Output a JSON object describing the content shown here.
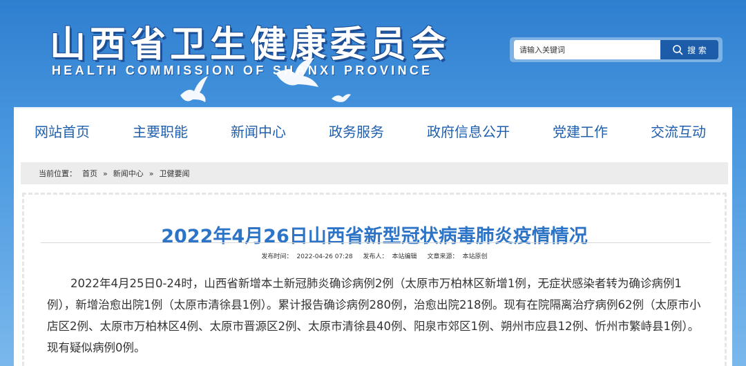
{
  "header": {
    "title": "山西省卫生健康委员会",
    "subtitle": "HEALTH COMMISSION OF SHANXI PROVINCE"
  },
  "search": {
    "placeholder": "请输入关键词",
    "button_label": "搜 索",
    "icon": "search-icon"
  },
  "nav": {
    "items": [
      {
        "label": "网站首页"
      },
      {
        "label": "主要职能"
      },
      {
        "label": "新闻中心"
      },
      {
        "label": "政务服务"
      },
      {
        "label": "政府信息公开"
      },
      {
        "label": "党建工作"
      },
      {
        "label": "交流互动"
      }
    ]
  },
  "breadcrumb": {
    "prefix": "当前位置：",
    "items": [
      "首页",
      "新闻中心",
      "卫健要闻"
    ],
    "separator": "»"
  },
  "article": {
    "title": "2022年4月26日山西省新型冠状病毒肺炎疫情情况",
    "meta": {
      "publish_time_label": "发布时间：",
      "publish_time": "2022-04-26 07:28",
      "publisher_label": "发布人：",
      "publisher": "本站编辑",
      "source_label": "文章来源：",
      "source": "本站原创"
    },
    "body": "2022年4月25日0-24时，山西省新增本土新冠肺炎确诊病例2例（太原市万柏林区新增1例，无症状感染者转为确诊病例1例），新增治愈出院1例（太原市清徐县1例）。累计报告确诊病例280例，治愈出院218例。现有在院隔离治疗病例62例（太原市小店区2例、太原市万柏林区4例、太原市晋源区2例、太原市清徐县40例、阳泉市郊区1例、朔州市应县12例、忻州市繁峙县1例）。现有疑似病例0例。"
  },
  "colors": {
    "header_bg": "#3a8ad8",
    "nav_text": "#1f5fae",
    "title_text": "#2d74c7",
    "search_button": "#1d5ca8"
  }
}
